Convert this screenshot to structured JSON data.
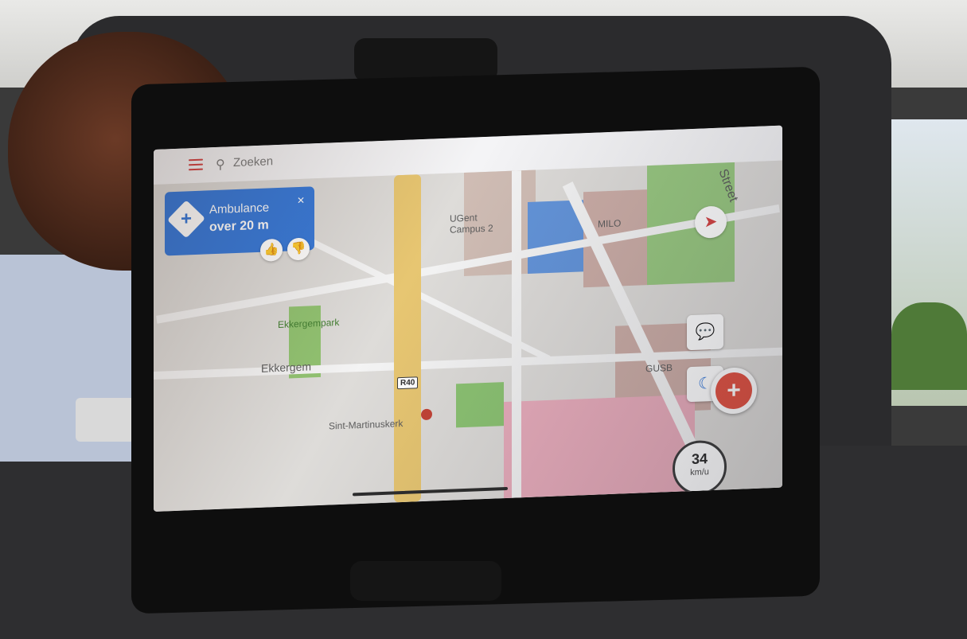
{
  "search": {
    "placeholder": "Zoeken"
  },
  "notification": {
    "title": "Ambulance",
    "distance": "over 20 m",
    "close_icon": "close-icon",
    "thumbs_up_icon": "thumbs-up-icon",
    "thumbs_down_icon": "thumbs-down-icon"
  },
  "map": {
    "labels": {
      "park": "Ekkergempark",
      "district": "Ekkergem",
      "church": "Sint-Martinuskerk",
      "building1": "UGent Campus 2",
      "building2": "MILO",
      "building3": "GUSB",
      "street": "Street"
    },
    "road_shield": "R40"
  },
  "speed": {
    "value": "34",
    "unit": "km/u"
  },
  "colors": {
    "accent": "#2f74d8",
    "route": "#e6c36a",
    "report": "#e04a3a",
    "menu": "#d23b3b"
  }
}
